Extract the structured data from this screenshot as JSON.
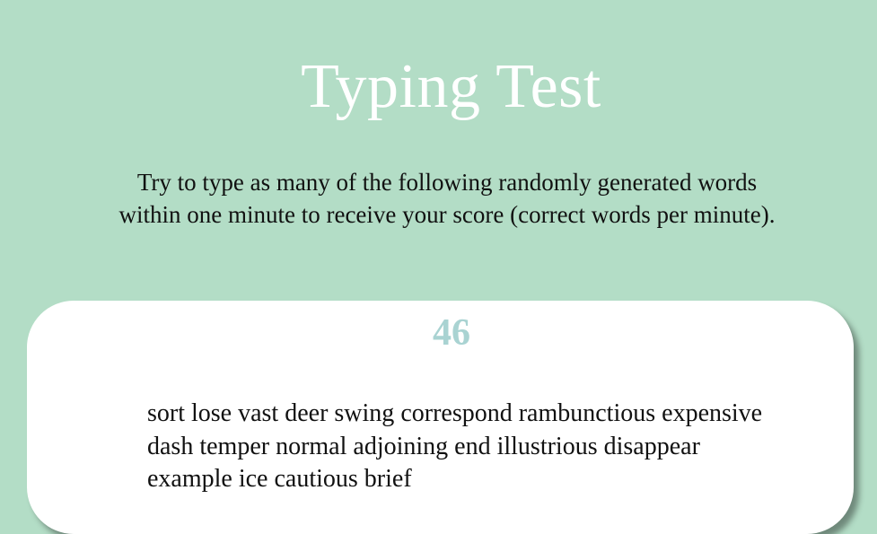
{
  "header": {
    "title": "Typing Test",
    "instructions": "Try to type as many of the following randomly generated words within one minute to receive your score (correct words per minute)."
  },
  "test": {
    "timer": "46",
    "words": [
      "sort",
      "lose",
      "vast",
      "deer",
      "swing",
      "correspond",
      "rambunctious",
      "expensive",
      "dash",
      "temper",
      "normal",
      "adjoining",
      "end",
      "illustrious",
      "disappear",
      "example",
      "ice",
      "cautious",
      "brief"
    ]
  },
  "colors": {
    "background": "#b3ddc6",
    "card": "#ffffff",
    "timer": "#a9d3d2",
    "title": "#ffffff",
    "text": "#111111"
  }
}
